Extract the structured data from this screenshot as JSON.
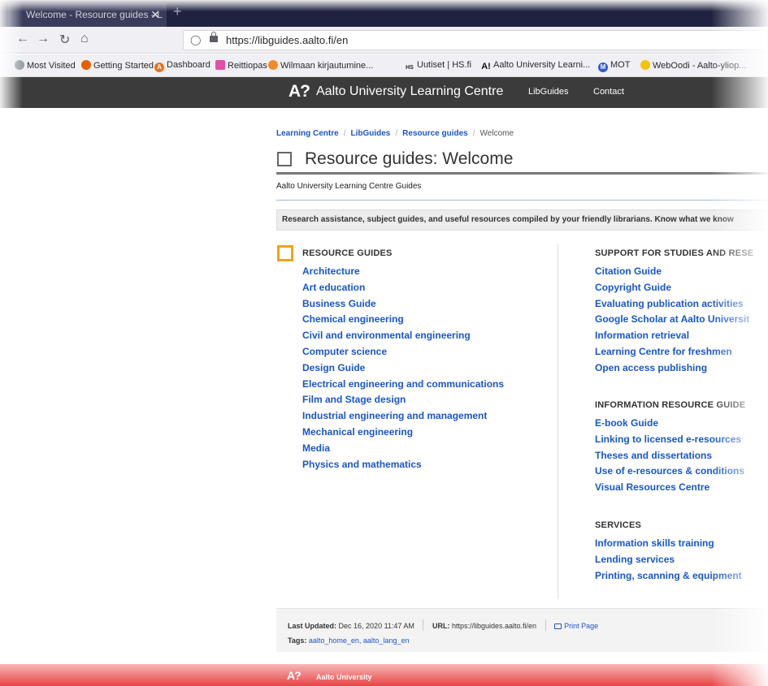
{
  "browser": {
    "tab_title": "Welcome - Resource guides - L",
    "tab_close": "✕",
    "new_tab": "+",
    "url": "https://libguides.aalto.fi/en",
    "nav": {
      "back": "←",
      "forward": "→",
      "reload": "↻",
      "home": "⌂"
    },
    "bookmarks": [
      {
        "label": "Most Visited",
        "icon": "globe-icon",
        "color": "#9aa0a6"
      },
      {
        "label": "Getting Started",
        "icon": "firefox-icon",
        "color": "#e66000"
      },
      {
        "label": "Dashboard",
        "icon": "dashboard-icon",
        "color": "#e8731b"
      },
      {
        "label": "Reittiopas",
        "icon": "map-icon",
        "color": "#e24fa6"
      },
      {
        "label": "Wilmaan kirjautumine...",
        "icon": "wilma-icon",
        "color": "#f28c28"
      },
      {
        "label": "Uutiset | HS.fi",
        "icon": "hs-icon",
        "color": "#222222"
      },
      {
        "label": "Aalto University Learni...",
        "icon": "aalto-icon",
        "color": "#111111"
      },
      {
        "label": "MOT",
        "icon": "mot-icon",
        "color": "#2f5bd6"
      },
      {
        "label": "WebOodi - Aalto-yliop...",
        "icon": "weboodi-icon",
        "color": "#f4c20d"
      }
    ]
  },
  "header": {
    "logo": "A?",
    "site_title": "Aalto University Learning Centre",
    "nav": [
      "LibGuides",
      "Contact"
    ]
  },
  "breadcrumb": {
    "items": [
      "Learning Centre",
      "LibGuides",
      "Resource guides"
    ],
    "current": "Welcome",
    "separator": "/"
  },
  "page": {
    "title": "Resource guides: Welcome",
    "subtitle": "Aalto University Learning Centre Guides",
    "intro": "Research assistance, subject guides, and useful resources compiled by your friendly librarians. Know what we know"
  },
  "resource_guides": {
    "heading": "RESOURCE GUIDES",
    "links": [
      "Architecture",
      "Art education",
      "Business Guide",
      "Chemical engineering",
      "Civil and environmental engineering",
      "Computer science",
      "Design Guide",
      "Electrical engineering and communications",
      "Film and Stage design",
      "Industrial engineering and management",
      "Mechanical engineering",
      "Media",
      "Physics and mathematics"
    ]
  },
  "support": {
    "heading": "SUPPORT FOR STUDIES AND RESE",
    "links": [
      "Citation Guide",
      "Copyright Guide",
      "Evaluating publication activities",
      "Google Scholar at Aalto Universit",
      "Information retrieval",
      "Learning Centre for freshmen",
      "Open access publishing"
    ]
  },
  "info_resources": {
    "heading": "INFORMATION RESOURCE GUIDE",
    "links": [
      "E-book Guide",
      "Linking to licensed e-resources",
      "Theses and dissertations",
      "Use of e-resources & conditions",
      "Visual Resources Centre"
    ]
  },
  "services": {
    "heading": "SERVICES",
    "links": [
      "Information skills training",
      "Lending services",
      "Printing, scanning & equipment"
    ]
  },
  "meta": {
    "last_updated_label": "Last Updated:",
    "last_updated": "Dec 16, 2020 11:47 AM",
    "url_label": "URL:",
    "url": "https://libguides.aalto.fi/en",
    "print": "Print Page",
    "tags_label": "Tags:",
    "tags": "aalto_home_en, aalto_lang_en"
  },
  "footer": {
    "logo": "A?",
    "name": "Aalto University"
  },
  "colors": {
    "link": "#1a56c9",
    "accent_orange": "#f2a31a",
    "header_bg": "#3b3b3b",
    "footer_red": "#e94444"
  }
}
